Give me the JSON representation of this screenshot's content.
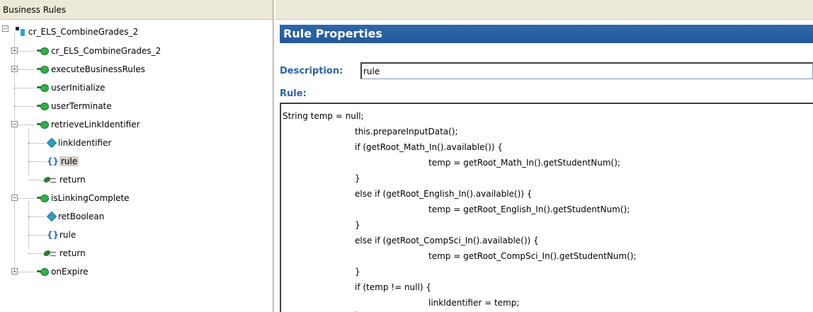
{
  "left_panel": {
    "title": "Business Rules",
    "tree": {
      "root": "cr_ELS_CombineGrades_2",
      "nodes": [
        {
          "label": "cr_ELS_CombineGrades_2",
          "icon": "rule-icon",
          "toggle": "+"
        },
        {
          "label": "executeBusinessRules",
          "icon": "rule-icon",
          "toggle": "+"
        },
        {
          "label": "userInitialize",
          "icon": "rule-icon"
        },
        {
          "label": "userTerminate",
          "icon": "rule-icon"
        },
        {
          "label": "retrieveLinkIdentifier",
          "icon": "rule-icon",
          "toggle": "−",
          "children": [
            {
              "label": "linkIdentifier",
              "icon": "parameter-icon"
            },
            {
              "label": "rule",
              "icon": "braces-icon",
              "selected": true
            },
            {
              "label": "return",
              "icon": "return-icon"
            }
          ]
        },
        {
          "label": "isLinkingComplete",
          "icon": "rule-icon",
          "toggle": "−",
          "children": [
            {
              "label": "retBoolean",
              "icon": "parameter-icon"
            },
            {
              "label": "rule",
              "icon": "braces-icon"
            },
            {
              "label": "return",
              "icon": "return-icon"
            }
          ]
        },
        {
          "label": "onExpire",
          "icon": "rule-icon",
          "toggle": "+"
        }
      ]
    }
  },
  "right_panel": {
    "title": "Rule Properties",
    "description_label": "Description:",
    "description_value": "rule",
    "rule_label": "Rule:",
    "code_lines": [
      "String temp = null;",
      "this.prepareInputData();",
      "if (getRoot_Math_In().available()) {",
      "temp = getRoot_Math_In().getStudentNum();",
      "}",
      "else if (getRoot_English_In().available()) {",
      "temp = getRoot_English_In().getStudentNum();",
      "}",
      "else if (getRoot_CompSci_In().available()) {",
      "temp = getRoot_CompSci_In().getStudentNum();",
      "}",
      "if (temp != null) {",
      "linkIdentifier = temp;",
      "}"
    ]
  },
  "colors": {
    "header_bar": "#2f67a8",
    "label_blue": "#2d62a6",
    "panel_gray": "#ece9d8"
  }
}
